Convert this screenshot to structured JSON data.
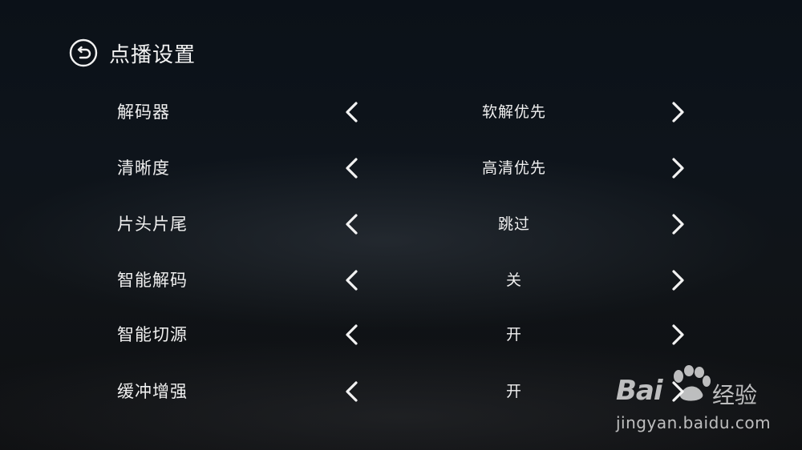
{
  "header": {
    "title": "点播设置",
    "back_icon": "back-icon"
  },
  "settings": [
    {
      "label": "解码器",
      "value": "软解优先"
    },
    {
      "label": "清晰度",
      "value": "高清优先"
    },
    {
      "label": "片头片尾",
      "value": "跳过"
    },
    {
      "label": "智能解码",
      "value": "关"
    },
    {
      "label": "智能切源",
      "value": "开"
    },
    {
      "label": "缓冲增强",
      "value": "开"
    }
  ],
  "icons": {
    "prev": "chevron-left-icon",
    "next": "chevron-right-icon"
  },
  "watermark": {
    "logo_text": "Bai",
    "logo_suffix": "经验",
    "url": "jingyan.baidu.com"
  },
  "colors": {
    "text": "#f0f0f0",
    "background": "#0e141b"
  }
}
